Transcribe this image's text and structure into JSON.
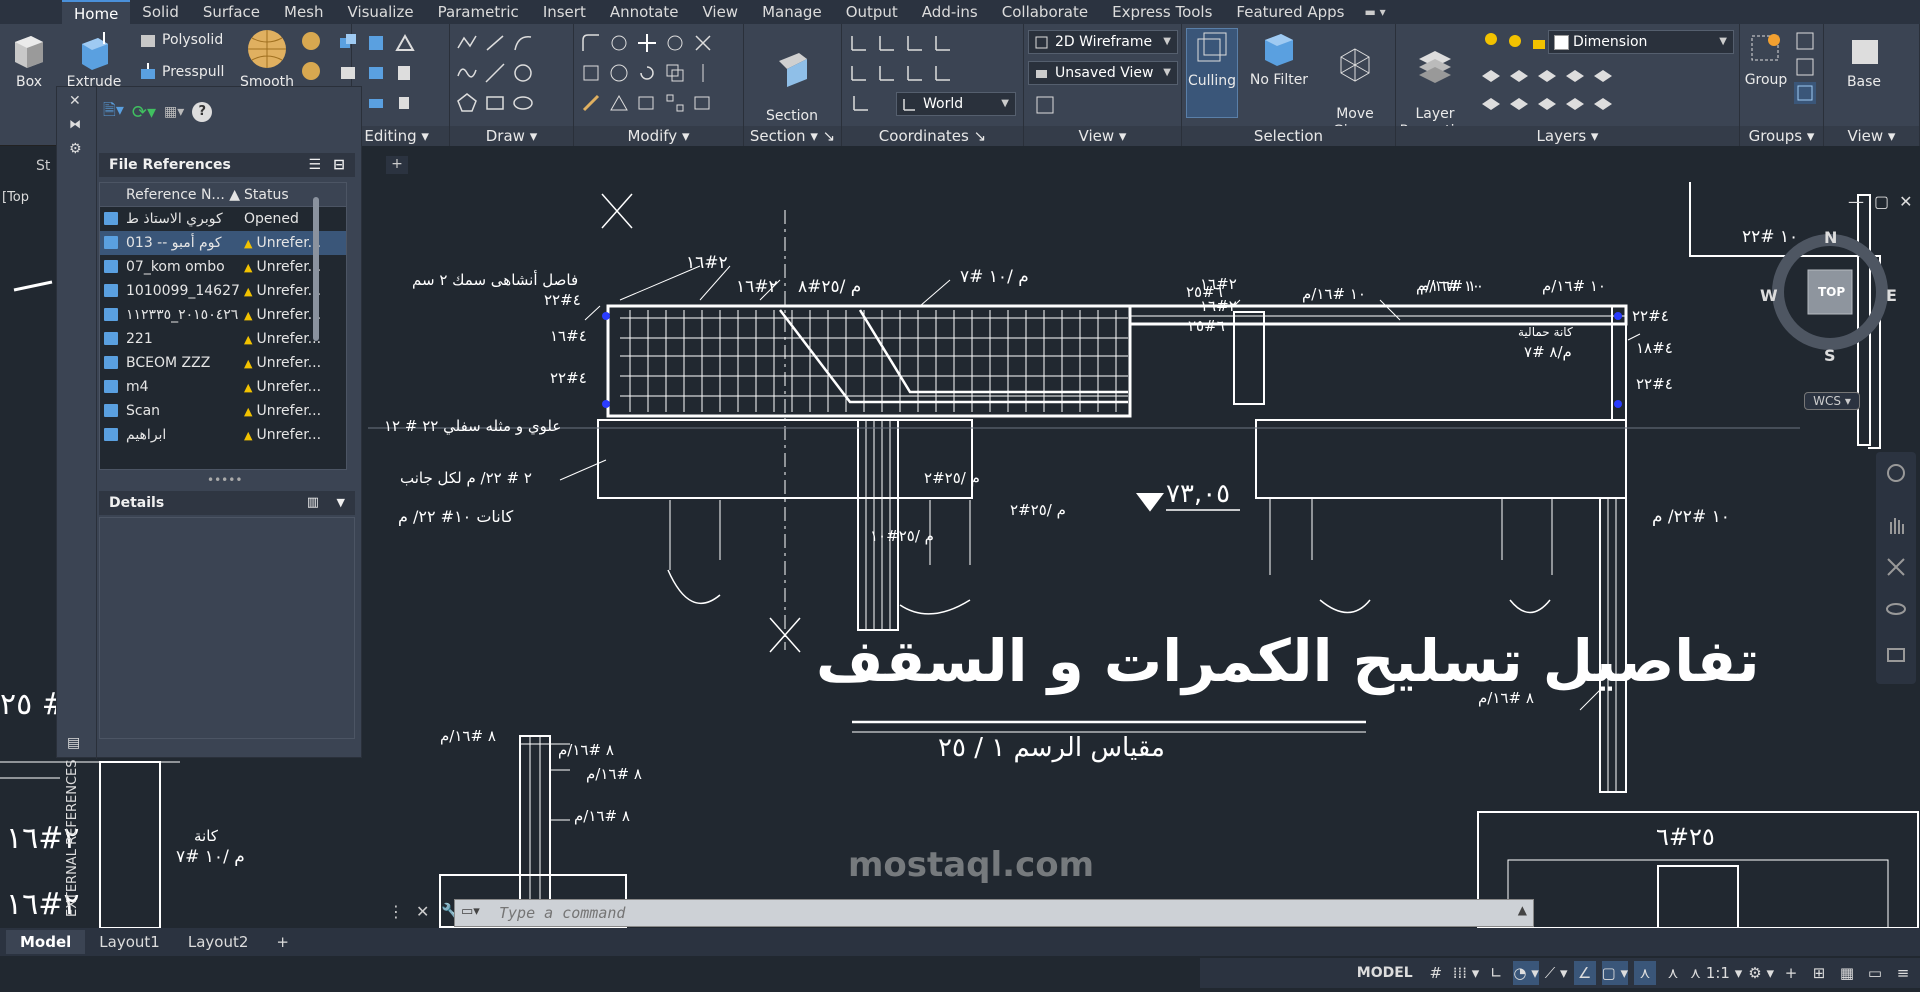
{
  "ribbon_tabs": [
    "Home",
    "Solid",
    "Surface",
    "Mesh",
    "Visualize",
    "Parametric",
    "Insert",
    "Annotate",
    "View",
    "Manage",
    "Output",
    "Add-ins",
    "Collaborate",
    "Express Tools",
    "Featured Apps"
  ],
  "ribbon": {
    "box_label": "Box",
    "extrude_label": "Extrude",
    "polysolid_label": "Polysolid",
    "presspull_label": "Presspull",
    "smooth_label": "Smooth",
    "solid_editing_title": "d Editing",
    "draw_title": "Draw",
    "modify_title": "Modify",
    "section_plane_label": "Section\nPlane",
    "section_title": "Section",
    "coordinates_title": "Coordinates",
    "world_combo": "World",
    "visual_style_combo": "2D Wireframe",
    "view_combo": "Unsaved View",
    "view_title": "View",
    "culling_label": "Culling",
    "no_filter_label": "No Filter",
    "move_gizmo_label": "Move\nGizmo",
    "selection_title": "Selection",
    "layer_properties_label": "Layer\nProperties",
    "layer_combo": "Dimension",
    "layers_title": "Layers",
    "group_label": "Group",
    "groups_title": "Groups",
    "base_label": "Base",
    "view2_title": "View"
  },
  "doc_tab_fragment": "St",
  "viewport_label": "[Top",
  "xref": {
    "file_references_title": "File References",
    "col_name": "Reference N...",
    "col_status": "Status",
    "rows": [
      {
        "name": "كوبري الاستاذ ط",
        "status": "Opened",
        "warn": false,
        "selected": false
      },
      {
        "name": "013 -- كوم أمبو",
        "status": "Unrefer...",
        "warn": true,
        "selected": true
      },
      {
        "name": "07_kom ombo",
        "status": "Unrefer...",
        "warn": true,
        "selected": false
      },
      {
        "name": "1010099_14627...",
        "status": "Unrefer...",
        "warn": true,
        "selected": false
      },
      {
        "name": "٢٠١٥٠٤٢٦_١١٢٣٣٥",
        "status": "Unrefer...",
        "warn": true,
        "selected": false
      },
      {
        "name": "221",
        "status": "Unrefer...",
        "warn": true,
        "selected": false
      },
      {
        "name": "BCEOM   ZZZ",
        "status": "Unrefer...",
        "warn": true,
        "selected": false
      },
      {
        "name": "m4",
        "status": "Unrefer...",
        "warn": true,
        "selected": false
      },
      {
        "name": "Scan",
        "status": "Unrefer...",
        "warn": true,
        "selected": false
      },
      {
        "name": "ابراهيم",
        "status": "Unrefer...",
        "warn": true,
        "selected": false
      }
    ],
    "details_title": "Details",
    "side_label": "EXTERNAL REFERENCES"
  },
  "drawing": {
    "title": "تفاصيل تسليح الكمرات و السقف",
    "scale_text": "مقياس الرسم   ١ / ٢٥",
    "level_text": "٧٣,٠٥",
    "labels": {
      "separator": "فاصل أنشاهى  سمك ٢ سم",
      "top_bottom": "علوي و مثله سفلي   ٢٢ # ١٢",
      "side": "٢ # ٢٢/ م لكل جانب",
      "stirrups": "كانات ١٠# ٢٢/ م",
      "b1": "٢#١٦",
      "b2": "٢#١٦",
      "b3": "م /٢٥#٨",
      "b4": "م /١٠ #٧",
      "b5": "٤#٢٢",
      "b6": "٤#١٦",
      "b7": "٤#٢٢",
      "b8": "م /٢٥#٢",
      "b9": "م /٢٥#٢",
      "b10": "م /٢٥#١٠",
      "r1": "٦#٢٥",
      "r2": "١٠ #١٦/م",
      "r3": "١٠ #١٦/م",
      "r4": "٢#١٦",
      "r5": "٢#١٦",
      "r6": "٦#٢٥",
      "r7": "١٠ #١٦/م",
      "r8": "١٠ #١٦/م",
      "r9": "٤#٢٢",
      "r10": "٤#١٨",
      "r11": "٤#٢٢",
      "r12": "كانة حمالية",
      "r13": "م/٨ #٧",
      "r14": "١٠ #٢٢/ م",
      "r15": "٨ #١٦/م",
      "r16": "١٠ #٢٢",
      "l1": "٨ #١٦/م",
      "l2": "٨ #١٦/م",
      "l3": "٨ #١٦/م",
      "l4": "٨ #١٦/م",
      "bl1": "٢#١٦",
      "bl2": "كانة",
      "bl3": "م /١٠ #٧",
      "bl4": "٢#١٦",
      "br1": "٢٥#٦",
      "left_frag": "٢٥ #"
    }
  },
  "viewcube": {
    "face": "TOP",
    "n": "N",
    "s": "S",
    "e": "E",
    "w": "W",
    "wcs": "WCS"
  },
  "command_placeholder": "Type a command",
  "layout_tabs": [
    "Model",
    "Layout1",
    "Layout2"
  ],
  "status": {
    "model": "MODEL",
    "scale": "1:1"
  },
  "watermark": "mostaql.com"
}
